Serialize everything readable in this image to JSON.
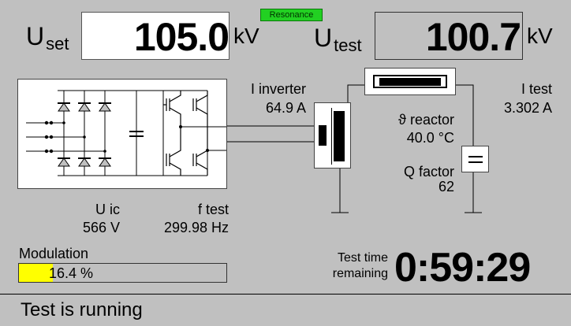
{
  "setpoint": {
    "label": "U",
    "sub": "set",
    "value": "105.0",
    "unit": "kV"
  },
  "test_voltage": {
    "label": "U",
    "sub": "test",
    "value": "100.7",
    "unit": "kV"
  },
  "resonance_badge": "Resonance",
  "inverter_current": {
    "label": "I inverter",
    "value": "64.9 A"
  },
  "test_current": {
    "label": "I test",
    "value": "3.302 A"
  },
  "reactor_temp": {
    "label": "ϑ reactor",
    "value": "40.0 °C"
  },
  "q_factor": {
    "label": "Q factor",
    "value": "62"
  },
  "u_ic": {
    "label": "U ic",
    "value": "566 V"
  },
  "f_test": {
    "label": "f test",
    "value": "299.98 Hz"
  },
  "modulation": {
    "label": "Modulation",
    "value_text": "16.4 %",
    "fraction": 0.164
  },
  "test_time": {
    "label_line1": "Test time",
    "label_line2": "remaining",
    "value": "0:59:29"
  },
  "status": "Test is running",
  "colors": {
    "background": "#c0c0c0",
    "badge": "#22d022",
    "modulation_fill": "#ffff00"
  }
}
